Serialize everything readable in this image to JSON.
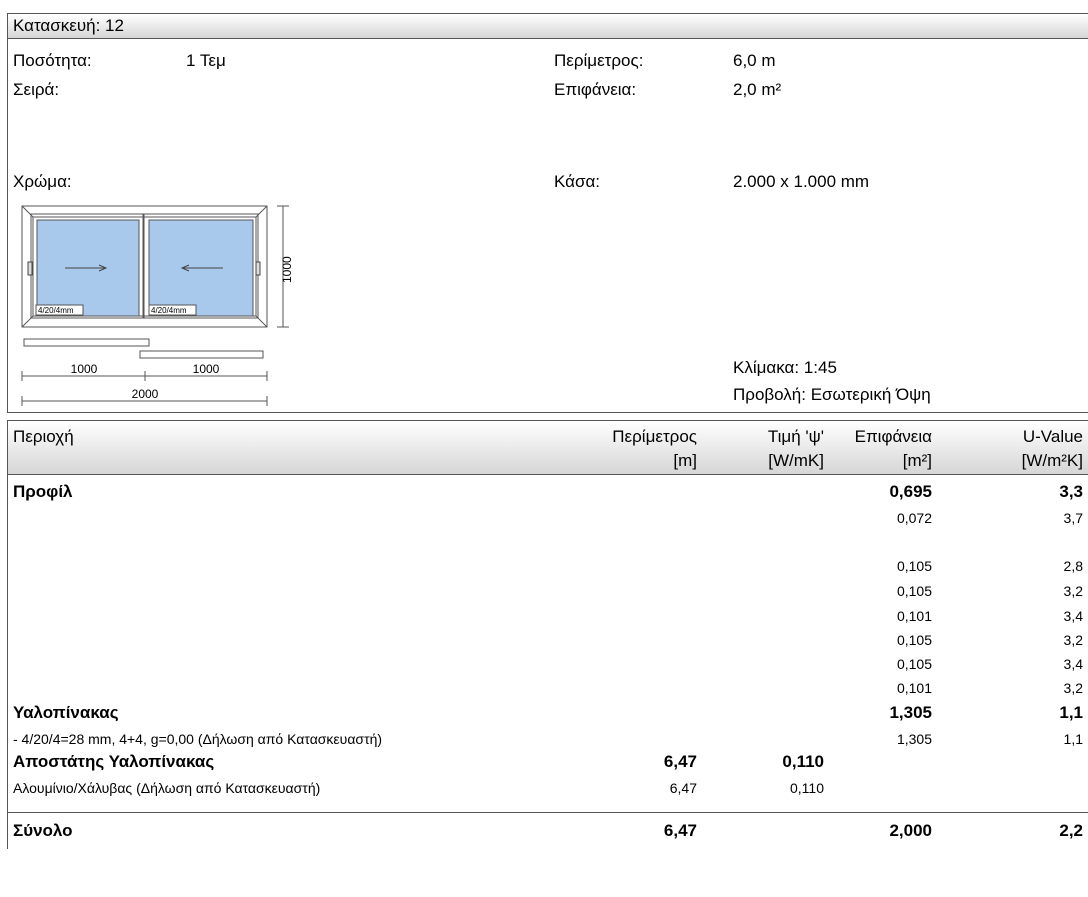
{
  "header": {
    "title": "Κατασκευή: 12"
  },
  "info": {
    "qty_label": "Ποσότητα:",
    "qty_value": "1 Τεμ",
    "series_label": "Σειρά:",
    "color_label": "Χρώμα:",
    "perimeter_label": "Περίμετρος:",
    "perimeter_value": "6,0 m",
    "surface_label": "Επιφάνεια:",
    "surface_value": "2,0 m²",
    "frame_label": "Κάσα:",
    "frame_value": "2.000 x 1.000 mm",
    "scale": "Κλίμακα: 1:45",
    "view": "Προβολή: Εσωτερική Όψη"
  },
  "drawing": {
    "glass_left": "4/20/4mm",
    "glass_right": "4/20/4mm",
    "dim_height": "1000",
    "dim_left": "1000",
    "dim_right": "1000",
    "dim_total": "2000",
    "glass_color": "#a8c8ec"
  },
  "table": {
    "headers": {
      "area": "Περιοχή",
      "perimeter": "Περίμετρος",
      "perimeter_unit": "[m]",
      "psi": "Τιμή 'ψ'",
      "psi_unit": "[W/mK]",
      "surface": "Επιφάνεια",
      "surface_unit": "[m²]",
      "u": "U-Value",
      "u_unit": "[W/m²K]"
    },
    "profile": {
      "label": "Προφίλ",
      "surface": "0,695",
      "u": "3,3"
    },
    "profile_rows": [
      {
        "surface": "0,072",
        "u": "3,7"
      },
      {
        "surface": "0,105",
        "u": "2,8"
      },
      {
        "surface": "0,105",
        "u": "3,2"
      },
      {
        "surface": "0,101",
        "u": "3,4"
      },
      {
        "surface": "0,105",
        "u": "3,2"
      },
      {
        "surface": "0,105",
        "u": "3,4"
      },
      {
        "surface": "0,101",
        "u": "3,2"
      }
    ],
    "glass": {
      "label": "Υαλοπίνακας",
      "surface": "1,305",
      "u": "1,1"
    },
    "glass_row": {
      "label": "- 4/20/4=28 mm, 4+4, g=0,00 (Δήλωση από Κατασκευαστή)",
      "surface": "1,305",
      "u": "1,1"
    },
    "spacer": {
      "label": "Αποστάτης Υαλοπίνακας",
      "perimeter": "6,47",
      "psi": "0,110"
    },
    "spacer_row": {
      "label": "Αλουμίνιο/Χάλυβας (Δήλωση από Κατασκευαστή)",
      "perimeter": "6,47",
      "psi": "0,110"
    },
    "total": {
      "label": "Σύνολο",
      "perimeter": "6,47",
      "surface": "2,000",
      "u": "2,2"
    }
  }
}
